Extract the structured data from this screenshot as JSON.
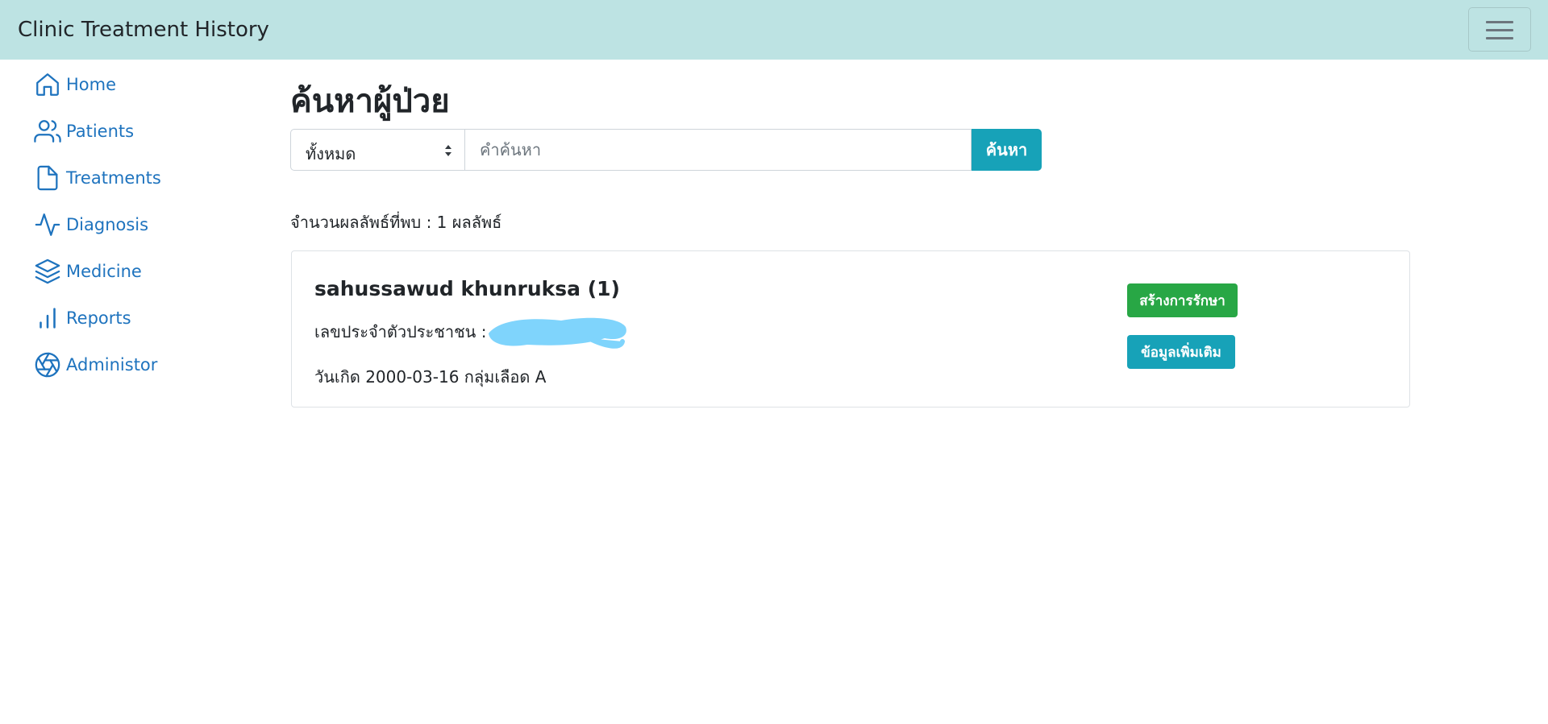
{
  "app": {
    "title": "Clinic Treatment History",
    "menu_icon": "hamburger-icon"
  },
  "sidebar": {
    "items": [
      {
        "label": "Home",
        "icon": "home-icon"
      },
      {
        "label": "Patients",
        "icon": "users-icon"
      },
      {
        "label": "Treatments",
        "icon": "file-icon"
      },
      {
        "label": "Diagnosis",
        "icon": "activity-icon"
      },
      {
        "label": "Medicine",
        "icon": "layers-icon"
      },
      {
        "label": "Reports",
        "icon": "bar-chart-icon"
      },
      {
        "label": "Administor",
        "icon": "aperture-icon"
      }
    ]
  },
  "main": {
    "title": "ค้นหาผู้ป่วย",
    "filter": {
      "selected": "ทั้งหมด"
    },
    "search": {
      "placeholder": "คำค้นหา",
      "value": "",
      "button_label": "ค้นหา"
    },
    "result_count": "จำนวนผลลัพธ์ที่พบ : 1 ผลลัพธ์",
    "results": [
      {
        "name": "sahussawud khunruksa (1)",
        "id_label": "เลขประจำตัวประชาชน : ",
        "birth_info": "วันเกิด 2000-03-16 กลุ่มเลือด A",
        "create_button": "สร้างการรักษา",
        "info_button": "ข้อมูลเพิ่มเติม"
      }
    ]
  },
  "colors": {
    "navbar_bg": "#bde3e3",
    "link": "#1e73be",
    "info": "#17a2b8",
    "success": "#28a745",
    "redaction": "#7fd4fc"
  }
}
